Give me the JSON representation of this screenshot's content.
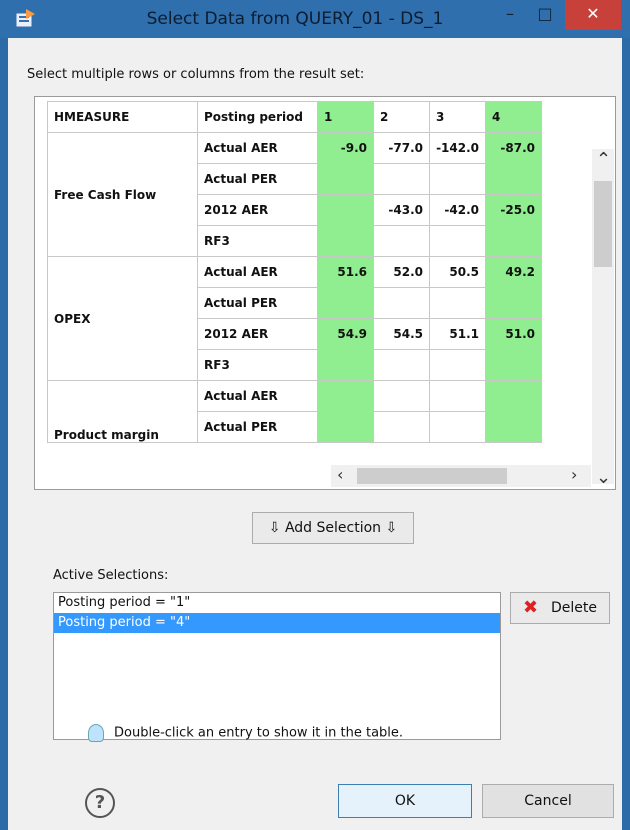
{
  "window": {
    "title": "Select Data from QUERY_01 - DS_1",
    "minimize": "–",
    "maximize": "□",
    "close": "✕"
  },
  "prompt": "Select multiple rows or columns from the result set:",
  "table": {
    "headers": [
      "HMEASURE",
      "Posting period",
      "1",
      "2",
      "3",
      "4"
    ],
    "groups": [
      {
        "measure": "Free Cash Flow",
        "rows": [
          {
            "period": "Actual AER",
            "values": [
              "-9.0",
              "-77.0",
              "-142.0",
              "-87.0"
            ]
          },
          {
            "period": "Actual PER",
            "values": [
              "",
              "",
              "",
              ""
            ]
          },
          {
            "period": "2012 AER",
            "values": [
              "",
              "-43.0",
              "-42.0",
              "-25.0"
            ]
          },
          {
            "period": "RF3",
            "values": [
              "",
              "",
              "",
              ""
            ]
          }
        ]
      },
      {
        "measure": "OPEX",
        "rows": [
          {
            "period": "Actual AER",
            "values": [
              "51.6",
              "52.0",
              "50.5",
              "49.2"
            ]
          },
          {
            "period": "Actual PER",
            "values": [
              "",
              "",
              "",
              ""
            ]
          },
          {
            "period": "2012 AER",
            "values": [
              "54.9",
              "54.5",
              "51.1",
              "51.0"
            ]
          },
          {
            "period": "RF3",
            "values": [
              "",
              "",
              "",
              ""
            ]
          }
        ]
      },
      {
        "measure": "Product margin",
        "rows": [
          {
            "period": "Actual AER",
            "values": [
              "",
              "",
              "",
              ""
            ]
          },
          {
            "period": "Actual PER",
            "values": [
              "",
              "",
              "",
              ""
            ]
          }
        ]
      }
    ],
    "highlight_color": "#90ee90"
  },
  "add_selection": "⇩ Add Selection ⇩",
  "active_label": "Active Selections:",
  "selections": [
    "Posting period = \"1\"",
    "Posting period = \"4\""
  ],
  "delete_label": "Delete",
  "hint": "Double-click an entry to show it in the table.",
  "help": "?",
  "ok": "OK",
  "cancel": "Cancel"
}
